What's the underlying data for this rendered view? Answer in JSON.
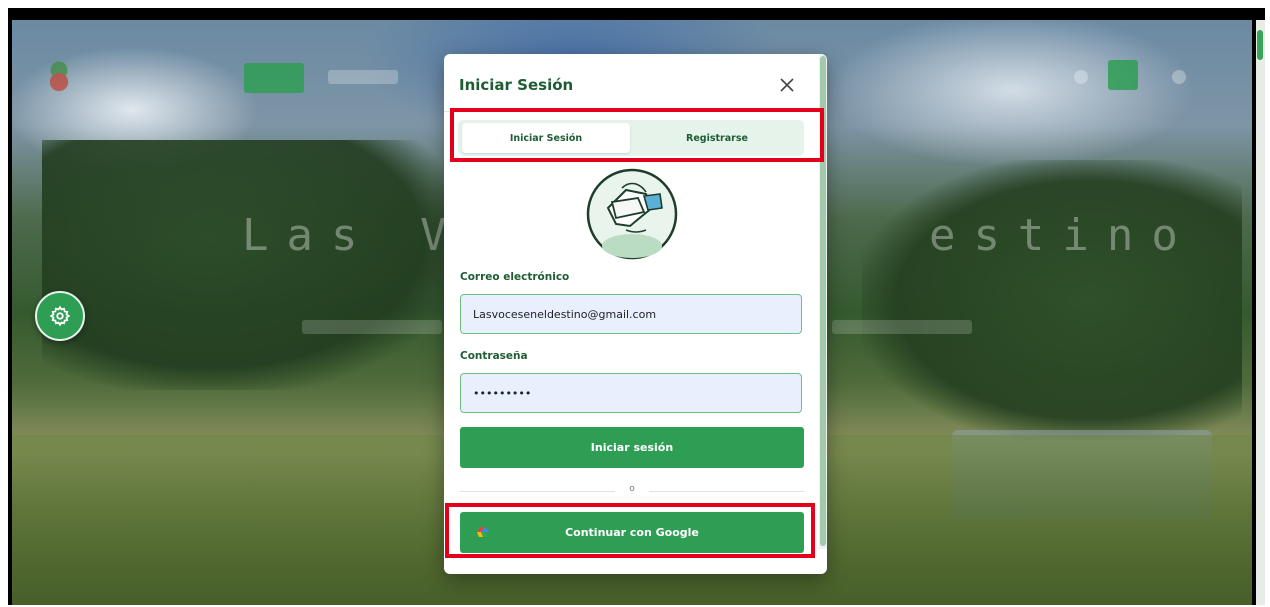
{
  "background": {
    "hero_title_left": "Las Vo",
    "hero_title_right": "estino"
  },
  "modal": {
    "title": "Iniciar Sesión",
    "close_icon": "close-icon",
    "tabs": [
      {
        "label": "Iniciar Sesión",
        "active": true
      },
      {
        "label": "Registrarse",
        "active": false
      }
    ],
    "email": {
      "label": "Correo electrónico",
      "value": "Lasvoceseneldestino@gmail.com"
    },
    "password": {
      "label": "Contraseña",
      "value": "pass12345"
    },
    "submit_label": "Iniciar sesión",
    "divider_text": "o",
    "google_label": "Continuar con Google"
  },
  "colors": {
    "primary": "#2f9e55",
    "title": "#1e5c34",
    "highlight": "#e4001b",
    "input_bg": "#e8f0fe"
  },
  "floating": {
    "settings_icon": "gear-icon"
  }
}
